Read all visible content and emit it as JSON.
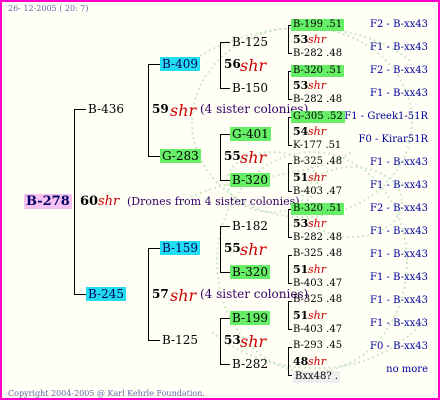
{
  "header": {
    "date_stamp": "26- 12-2005 ( 20: 7)"
  },
  "footer": {
    "copyright": "Copyright 2004-2005 @ Karl Kehrle Foundation."
  },
  "root": {
    "id": "B-278",
    "count": "60",
    "shr": "shr",
    "note": "(Drones from 4 sister colonies)"
  },
  "gen1": {
    "top": {
      "id": "B-436",
      "count": "59",
      "shr": "shr",
      "note": "(4 sister colonies)"
    },
    "bottom": {
      "id": "B-245",
      "count": "57",
      "shr": "shr",
      "note": "(4 sister colonies)"
    }
  },
  "gen2": {
    "a": {
      "id": "B-409",
      "count": "56",
      "shr": "shr"
    },
    "b": {
      "id": "G-283",
      "count": "55",
      "shr": "shr"
    },
    "c": {
      "id": "B-159",
      "count": "55",
      "shr": "shr"
    },
    "d": {
      "id": "B-125",
      "count": "53",
      "shr": "shr"
    }
  },
  "gen3": [
    {
      "id": "B-125"
    },
    {
      "id": "B-150"
    },
    {
      "id": "G-401"
    },
    {
      "id": "B-320"
    },
    {
      "id": "B-182"
    },
    {
      "id": "B-320"
    },
    {
      "id": "B-199"
    },
    {
      "id": "B-282"
    }
  ],
  "gen4": [
    {
      "top": "B-199 .51",
      "count": "53",
      "shr": "shr",
      "bottom": "B-282 .48"
    },
    {
      "top": "B-320 .51",
      "count": "53",
      "shr": "shr",
      "bottom": "B-282 .48"
    },
    {
      "top": "G-305 .52",
      "count": "54",
      "shr": "shr",
      "bottom": "K-177 .51"
    },
    {
      "top": "B-325 .48",
      "count": "51",
      "shr": "shr",
      "bottom": "B-403 .47"
    },
    {
      "top": "B-320 .51",
      "count": "53",
      "shr": "shr",
      "bottom": "B-282 .48"
    },
    {
      "top": "B-325 .48",
      "count": "51",
      "shr": "shr",
      "bottom": "B-403 .47"
    },
    {
      "top": "B-325 .48",
      "count": "51",
      "shr": "shr",
      "bottom": "B-403 .47"
    },
    {
      "top": "B-293 .45",
      "count": "48",
      "shr": "shr",
      "bottom": "Bxx48? ."
    }
  ],
  "right_labels": [
    "F2 - B-xx43",
    "F1 - B-xx43",
    "F2 - B-xx43",
    "F1 - B-xx43",
    "F1 - Greek1-51R",
    "F0 - Kirar51R",
    "F1 - B-xx43",
    "F1 - B-xx43",
    "F2 - B-xx43",
    "F1 - B-xx43",
    "F1 - B-xx43",
    "F1 - B-xx43",
    "F1 - B-xx43",
    "F1 - B-xx43",
    "F0 - B-xx43",
    "no more"
  ]
}
